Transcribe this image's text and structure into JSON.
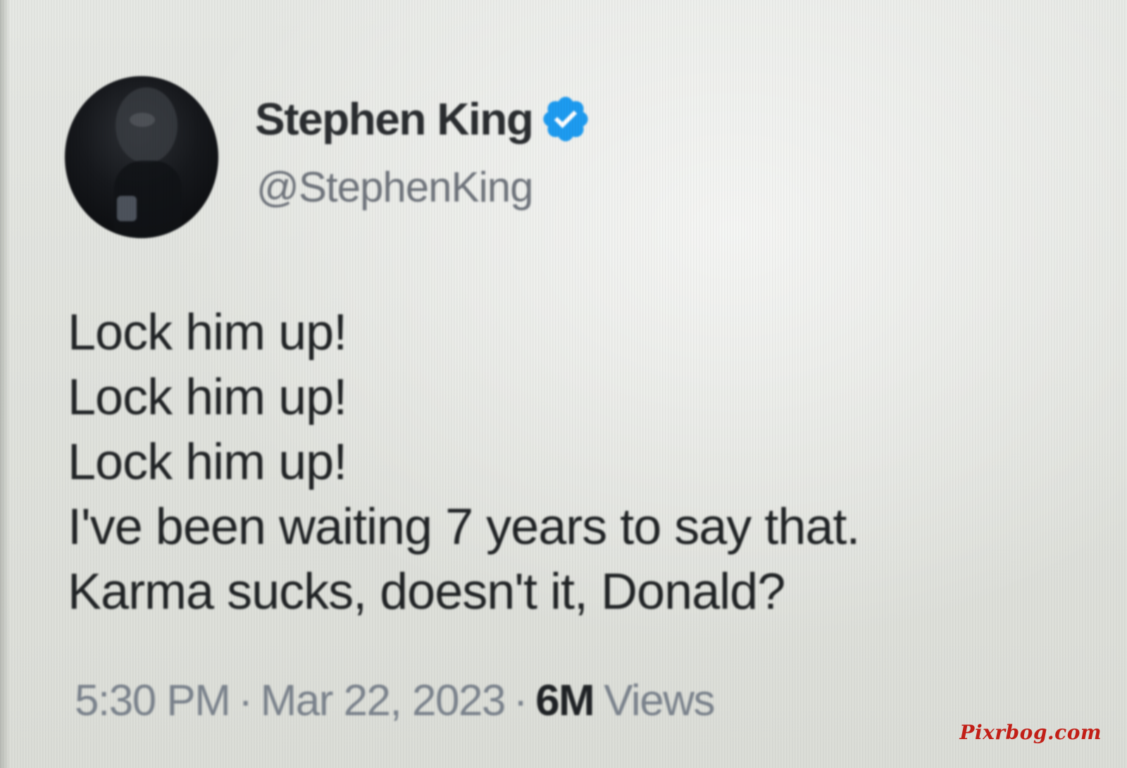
{
  "tweet": {
    "display_name": "Stephen King",
    "handle": "@StephenKing",
    "verified": true,
    "body_lines": [
      "Lock him up!",
      "Lock him up!",
      "Lock him up!",
      "I've been waiting 7 years to say that.",
      "Karma sucks, doesn't it, Donald?"
    ],
    "time": "5:30 PM",
    "date": "Mar 22, 2023",
    "separator": "·",
    "views_count": "6M",
    "views_label": "Views"
  },
  "watermark": "Pixrbog.com",
  "colors": {
    "verified_badge": "#1d9bf0",
    "name_text": "#2a2d30",
    "muted_text": "#7b838d",
    "watermark": "#c21f17"
  },
  "icons": {
    "verified": "verified-badge-icon",
    "avatar": "profile-avatar"
  }
}
